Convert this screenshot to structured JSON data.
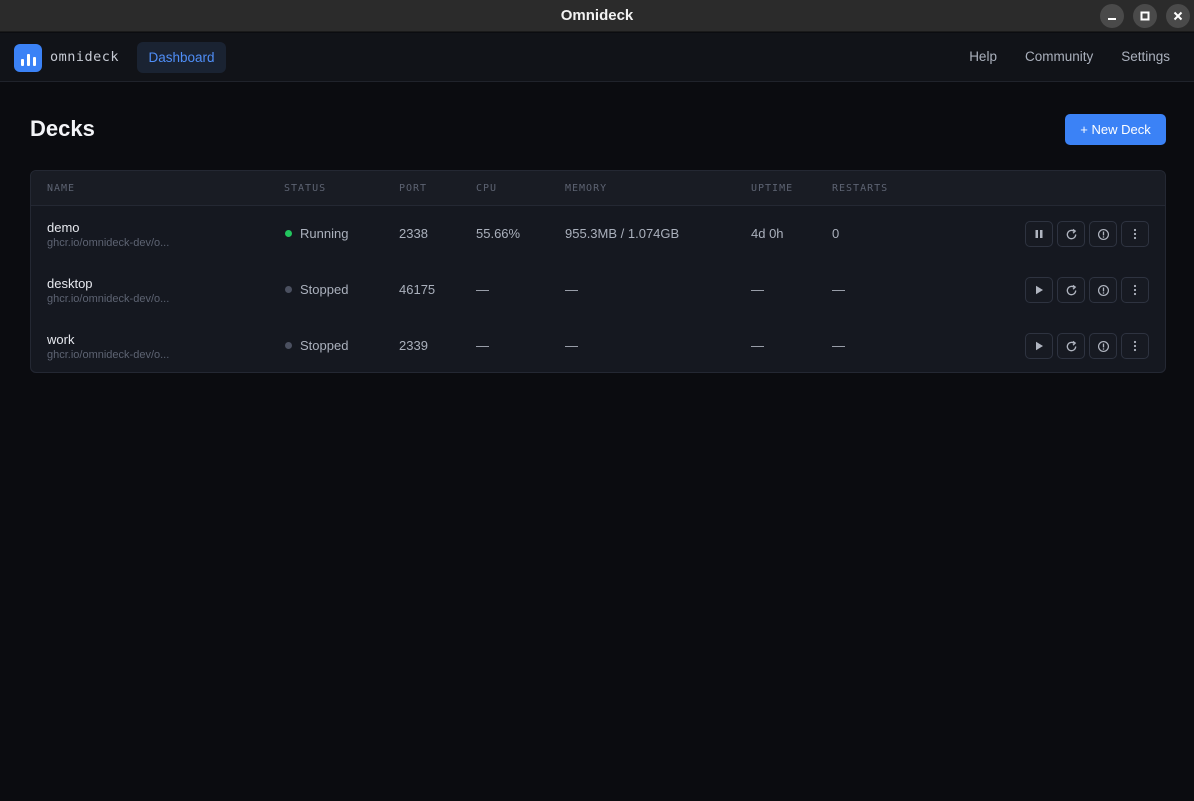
{
  "window": {
    "title": "Omnideck"
  },
  "nav": {
    "brand": "omnideck",
    "active_tab": "Dashboard",
    "links": [
      "Help",
      "Community",
      "Settings"
    ]
  },
  "page": {
    "title": "Decks",
    "new_button": "+ New Deck"
  },
  "table": {
    "columns": [
      "NAME",
      "STATUS",
      "PORT",
      "CPU",
      "MEMORY",
      "UPTIME",
      "RESTARTS"
    ],
    "rows": [
      {
        "name": "demo",
        "image": "ghcr.io/omnideck-dev/o...",
        "status": "Running",
        "status_color": "#22c55e",
        "port": "2338",
        "cpu": "55.66%",
        "memory": "955.3MB / 1.074GB",
        "uptime": "4d 0h",
        "restarts": "0",
        "primary_action": "pause-icon"
      },
      {
        "name": "desktop",
        "image": "ghcr.io/omnideck-dev/o...",
        "status": "Stopped",
        "status_color": "#4b5060",
        "port": "46175",
        "cpu": "—",
        "memory": "—",
        "uptime": "—",
        "restarts": "—",
        "primary_action": "play-icon"
      },
      {
        "name": "work",
        "image": "ghcr.io/omnideck-dev/o...",
        "status": "Stopped",
        "status_color": "#4b5060",
        "port": "2339",
        "cpu": "—",
        "memory": "—",
        "uptime": "—",
        "restarts": "—",
        "primary_action": "play-icon"
      }
    ]
  },
  "colors": {
    "accent": "#3b82f6",
    "running": "#22c55e",
    "stopped": "#4b5060"
  }
}
